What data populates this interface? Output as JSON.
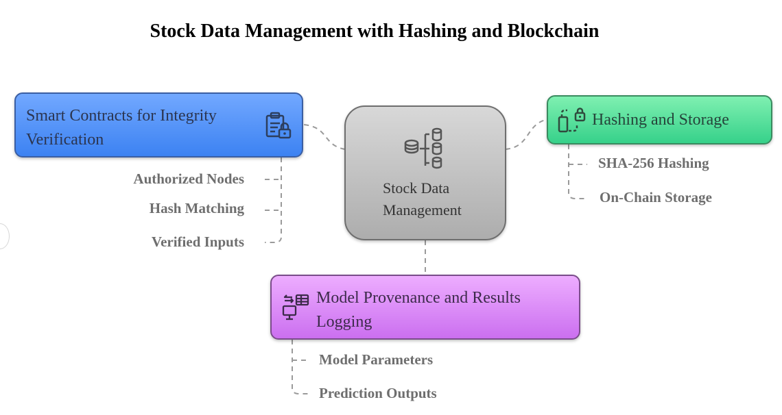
{
  "title": "Stock Data Management with Hashing and Blockchain",
  "center": {
    "label": "Stock Data Management",
    "icon": "database-tree-icon"
  },
  "nodes": {
    "integrity": {
      "label": "Smart Contracts for Integrity Verification",
      "icon": "clipboard-lock-icon",
      "color": "#4a8ef5",
      "leaves": [
        "Authorized Nodes",
        "Hash Matching",
        "Verified Inputs"
      ]
    },
    "hashing": {
      "label": "Hashing and Storage",
      "icon": "lock-blocks-icon",
      "color": "#4fe09a",
      "leaves": [
        "SHA-256 Hashing",
        "On-Chain Storage"
      ]
    },
    "provenance": {
      "label": "Model Provenance and Results Logging",
      "icon": "monitor-table-sync-icon",
      "color": "#d98af5",
      "leaves": [
        "Model Parameters",
        "Prediction Outputs"
      ]
    }
  },
  "colors": {
    "center": "#bdbdbd",
    "leaf_text": "#6e6e6e",
    "connector": "#9a9a9a"
  }
}
